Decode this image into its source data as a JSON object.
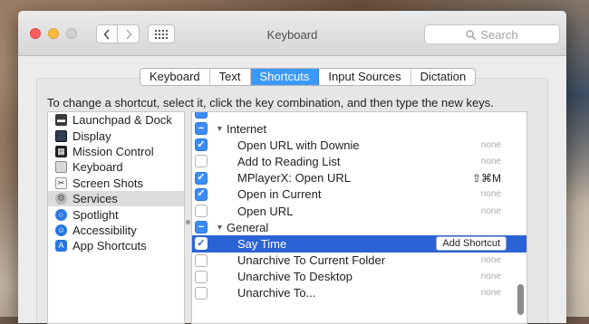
{
  "window": {
    "title": "Keyboard"
  },
  "search": {
    "placeholder": "Search"
  },
  "tabs": [
    {
      "label": "Keyboard",
      "active": false
    },
    {
      "label": "Text",
      "active": false
    },
    {
      "label": "Shortcuts",
      "active": true
    },
    {
      "label": "Input Sources",
      "active": false
    },
    {
      "label": "Dictation",
      "active": false
    }
  ],
  "instruction": "To change a shortcut, select it, click the key combination, and then type the new keys.",
  "categories": [
    {
      "label": "Launchpad & Dock",
      "icon": "launchpad-icon",
      "selected": false
    },
    {
      "label": "Display",
      "icon": "display-icon",
      "selected": false
    },
    {
      "label": "Mission Control",
      "icon": "mission-control-icon",
      "selected": false
    },
    {
      "label": "Keyboard",
      "icon": "keyboard-icon",
      "selected": false
    },
    {
      "label": "Screen Shots",
      "icon": "screenshot-icon",
      "selected": false
    },
    {
      "label": "Services",
      "icon": "gear-icon",
      "selected": true
    },
    {
      "label": "Spotlight",
      "icon": "spotlight-icon",
      "selected": false
    },
    {
      "label": "Accessibility",
      "icon": "accessibility-icon",
      "selected": false
    },
    {
      "label": "App Shortcuts",
      "icon": "app-shortcuts-icon",
      "selected": false
    }
  ],
  "shortcuts": {
    "groups": [
      {
        "name": "Internet",
        "items": [
          {
            "name": "Open URL with Downie",
            "checked": true,
            "key": "none"
          },
          {
            "name": "Add to Reading List",
            "checked": false,
            "key": "none"
          },
          {
            "name": "MPlayerX: Open URL",
            "checked": true,
            "key": "⇧⌘M"
          },
          {
            "name": "Open in Current",
            "checked": true,
            "key": "none"
          },
          {
            "name": "Open URL",
            "checked": false,
            "key": "none"
          }
        ]
      },
      {
        "name": "General",
        "items": [
          {
            "name": "Say Time",
            "checked": true,
            "key": "Add Shortcut",
            "selected": true
          },
          {
            "name": "Unarchive To Current Folder",
            "checked": false,
            "key": "none"
          },
          {
            "name": "Unarchive To Desktop",
            "checked": false,
            "key": "none"
          },
          {
            "name": "Unarchive To...",
            "checked": false,
            "key": "none"
          }
        ]
      }
    ]
  },
  "colors": {
    "accent": "#3b99fc",
    "selection": "#2b63d6"
  }
}
